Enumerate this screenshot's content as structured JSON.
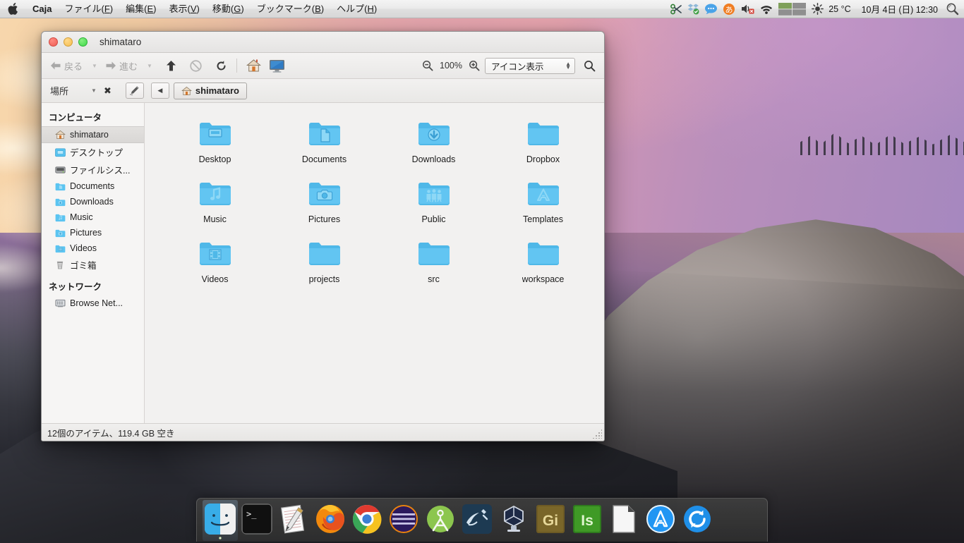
{
  "menubar": {
    "apple_icon": "apple-logo-icon",
    "app_name": "Caja",
    "items": [
      {
        "label": "ファイル",
        "mnemonic": "F"
      },
      {
        "label": "編集",
        "mnemonic": "E"
      },
      {
        "label": "表示",
        "mnemonic": "V"
      },
      {
        "label": "移動",
        "mnemonic": "G"
      },
      {
        "label": "ブックマーク",
        "mnemonic": "B"
      },
      {
        "label": "ヘルプ",
        "mnemonic": "H"
      }
    ],
    "tray": {
      "icons": [
        "scissors-network-icon",
        "dropbox-icon",
        "chat-bubble-icon",
        "input-method-icon",
        "volume-muted-icon",
        "wifi-icon",
        "workspace-switcher-icon",
        "weather-icon"
      ],
      "temperature": "25 °C",
      "datetime": "10月 4日 (日) 12:30",
      "search_icon": "spotlight-search-icon"
    }
  },
  "window": {
    "title": "shimataro",
    "traffic_lights": {
      "close": "close-button",
      "minimize": "minimize-button",
      "maximize": "maximize-button"
    },
    "toolbar": {
      "back_label": "戻る",
      "forward_label": "進む",
      "up_icon": "arrow-up-icon",
      "stop_icon": "stop-icon",
      "reload_icon": "reload-icon",
      "home_icon": "home-icon",
      "computer_icon": "computer-icon",
      "zoom_out_icon": "zoom-out-icon",
      "zoom_level": "100%",
      "zoom_in_icon": "zoom-in-icon",
      "view_mode": "アイコン表示",
      "search_icon": "search-icon"
    },
    "pathbar": {
      "location_label": "場所",
      "clear_icon": "clear-icon",
      "edit_icon": "edit-path-icon",
      "prev_icon": "chevron-left-icon",
      "breadcrumb": "shimataro",
      "breadcrumb_icon": "home-icon"
    },
    "sidebar": {
      "sections": [
        {
          "title": "コンピュータ",
          "items": [
            {
              "label": "shimataro",
              "icon": "home-icon",
              "selected": true
            },
            {
              "label": "デスクトップ",
              "icon": "desktop-folder-icon",
              "selected": false
            },
            {
              "label": "ファイルシス...",
              "icon": "harddisk-icon",
              "selected": false
            },
            {
              "label": "Documents",
              "icon": "documents-folder-icon",
              "selected": false
            },
            {
              "label": "Downloads",
              "icon": "downloads-folder-icon",
              "selected": false
            },
            {
              "label": "Music",
              "icon": "music-folder-icon",
              "selected": false
            },
            {
              "label": "Pictures",
              "icon": "pictures-folder-icon",
              "selected": false
            },
            {
              "label": "Videos",
              "icon": "videos-folder-icon",
              "selected": false
            },
            {
              "label": "ゴミ箱",
              "icon": "trash-icon",
              "selected": false
            }
          ]
        },
        {
          "title": "ネットワーク",
          "items": [
            {
              "label": "Browse Net...",
              "icon": "network-browse-icon",
              "selected": false
            }
          ]
        }
      ]
    },
    "files": [
      {
        "name": "Desktop",
        "icon": "desktop-folder-icon"
      },
      {
        "name": "Documents",
        "icon": "documents-folder-icon"
      },
      {
        "name": "Downloads",
        "icon": "downloads-folder-icon"
      },
      {
        "name": "Dropbox",
        "icon": "plain-folder-icon"
      },
      {
        "name": "Music",
        "icon": "music-folder-icon"
      },
      {
        "name": "Pictures",
        "icon": "pictures-folder-icon"
      },
      {
        "name": "Public",
        "icon": "public-folder-icon"
      },
      {
        "name": "Templates",
        "icon": "templates-folder-icon"
      },
      {
        "name": "Videos",
        "icon": "videos-folder-icon"
      },
      {
        "name": "projects",
        "icon": "plain-folder-icon"
      },
      {
        "name": "src",
        "icon": "plain-folder-icon"
      },
      {
        "name": "workspace",
        "icon": "plain-folder-icon"
      }
    ],
    "status": "12個のアイテム、119.4 GB 空き"
  },
  "dock": {
    "items": [
      {
        "name": "Finder",
        "icon": "finder-icon",
        "active": true
      },
      {
        "name": "Terminal",
        "icon": "terminal-icon",
        "active": false
      },
      {
        "name": "TextEdit",
        "icon": "texteditor-icon",
        "active": false
      },
      {
        "name": "Firefox",
        "icon": "firefox-icon",
        "active": false
      },
      {
        "name": "Google Chrome",
        "icon": "chrome-icon",
        "active": false
      },
      {
        "name": "Editor",
        "icon": "purple-orb-icon",
        "active": false
      },
      {
        "name": "Android Studio",
        "icon": "android-studio-icon",
        "active": false
      },
      {
        "name": "MySQL Workbench",
        "icon": "mysql-workbench-icon",
        "active": false
      },
      {
        "name": "VirtualBox",
        "icon": "virtualbox-icon",
        "active": false
      },
      {
        "name": "Gi",
        "icon": "gi-app-icon",
        "active": false,
        "badge": "Gi"
      },
      {
        "name": "Is",
        "icon": "is-app-icon",
        "active": false,
        "badge": "Is"
      },
      {
        "name": "LibreOffice",
        "icon": "libreoffice-icon",
        "active": false
      },
      {
        "name": "App Store",
        "icon": "appstore-icon",
        "active": false
      },
      {
        "name": "Software Update",
        "icon": "update-icon",
        "active": false
      }
    ]
  },
  "colors": {
    "accent_blue": "#5bc4f1",
    "folder_blue": "#4fb8e8",
    "traffic_red": "#ee5f55",
    "traffic_amber": "#f5bd4f",
    "traffic_green": "#3fd84a"
  }
}
